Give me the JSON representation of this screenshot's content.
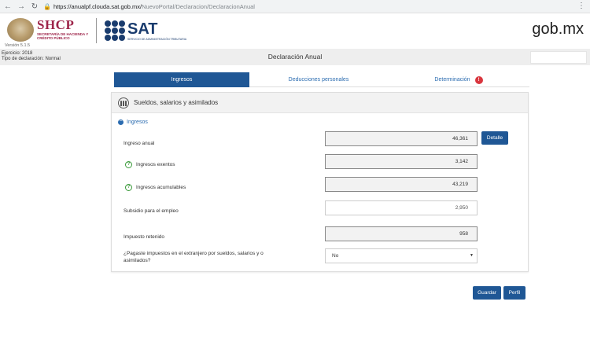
{
  "browser": {
    "url_host": "https://anualpf.clouda.sat.gob.mx/",
    "url_path": "NuevoPortal/Declaracion/DeclaracionAnual"
  },
  "header": {
    "shcp_title": "SHCP",
    "shcp_subtitle": "SECRETARÍA DE HACIENDA Y CRÉDITO PÚBLICO",
    "version": "Versión 5.1.5",
    "sat_title": "SAT",
    "sat_subtitle": "SERVICIO DE ADMINISTRACIÓN TRIBUTARIA",
    "gobmx": "gob.mx"
  },
  "titleband": {
    "ejercicio": "Ejercicio: 2018",
    "tipo": "Tipo de declaración: Normal",
    "title": "Declaración Anual"
  },
  "tabs": {
    "ingresos": "Ingresos",
    "deducciones": "Deducciones personales",
    "determinacion": "Determinación",
    "determinacion_badge": "!"
  },
  "panel": {
    "title": "Sueldos, salarios y asimilados",
    "section": "Ingresos",
    "rows": {
      "ingreso_anual": {
        "label": "Ingreso anual",
        "value": "46,361"
      },
      "ingresos_exentos": {
        "label": "Ingresos exentos",
        "value": "3,142"
      },
      "ingresos_acumulables": {
        "label": "Ingresos acumulables",
        "value": "43,219"
      },
      "subsidio": {
        "label": "Subsidio para el empleo",
        "value": "2,950"
      },
      "impuesto_retenido": {
        "label": "Impuesto retenido",
        "value": "958"
      },
      "extranjero": {
        "label": "¿Pagaste impuestos en el extranjero por sueldos, salarios y o asimilados?",
        "value": "No"
      }
    },
    "detalle_label": "Detalle"
  },
  "actions": {
    "guardar": "Guardar",
    "perfil": "Perfil"
  },
  "colors": {
    "primary": "#1f5795",
    "shcp": "#9d2449",
    "sat": "#1a3c6e",
    "badge": "#d9363e"
  }
}
